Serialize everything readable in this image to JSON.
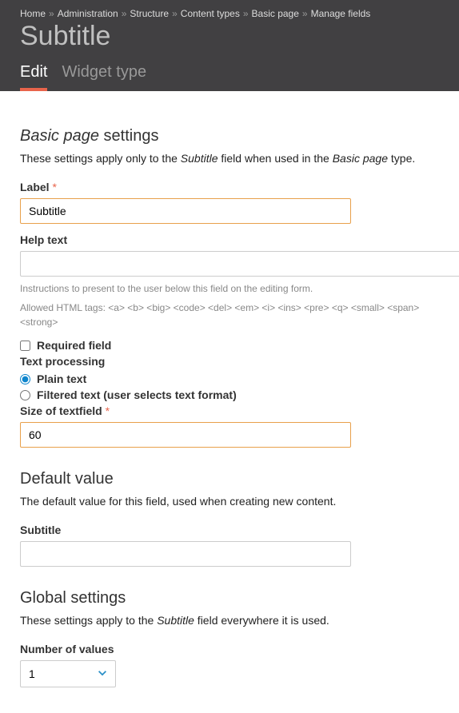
{
  "breadcrumb": [
    "Home",
    "Administration",
    "Structure",
    "Content types",
    "Basic page",
    "Manage fields"
  ],
  "page_title": "Subtitle",
  "tabs": {
    "edit": "Edit",
    "widget": "Widget type"
  },
  "section1": {
    "title_prefix": "Basic page",
    "title_suffix": " settings",
    "desc_1": "These settings apply only to the ",
    "desc_field": "Subtitle",
    "desc_2": " field when used in the ",
    "desc_type": "Basic page",
    "desc_3": " type."
  },
  "form": {
    "label_label": "Label",
    "label_value": "Subtitle",
    "help_label": "Help text",
    "help_value": "",
    "help_desc1": "Instructions to present to the user below this field on the editing form.",
    "help_desc2": "Allowed HTML tags: <a> <b> <big> <code> <del> <em> <i> <ins> <pre> <q> <small> <span> <strong>",
    "required_label": "Required field",
    "textproc_label": "Text processing",
    "plain_label": "Plain text",
    "filtered_label": "Filtered text (user selects text format)",
    "size_label": "Size of textfield",
    "size_value": "60"
  },
  "default_section": {
    "title": "Default value",
    "desc": "The default value for this field, used when creating new content.",
    "subtitle_label": "Subtitle",
    "subtitle_value": ""
  },
  "global_section": {
    "title": "Global settings",
    "desc_1": "These settings apply to the ",
    "desc_field": "Subtitle",
    "desc_2": " field everywhere it is used.",
    "numvals_label": "Number of values",
    "numvals_value": "1"
  }
}
